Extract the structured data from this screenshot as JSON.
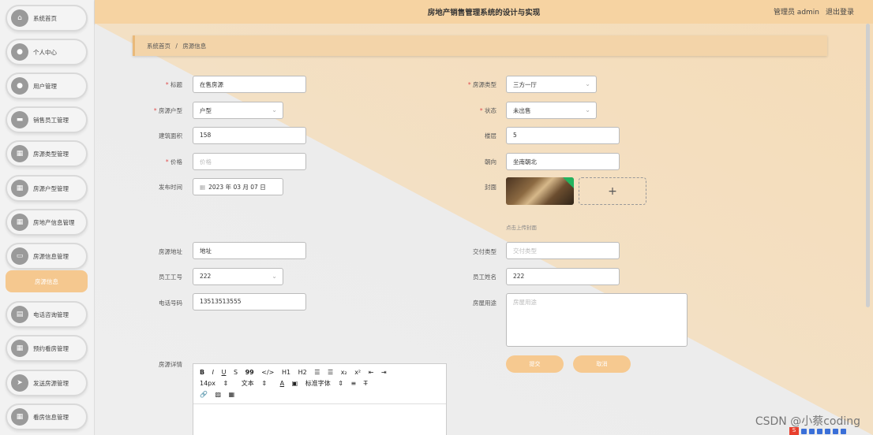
{
  "header": {
    "title": "房地产销售管理系统的设计与实现",
    "user": "管理员 admin",
    "logout": "退出登录"
  },
  "sidebar": {
    "items": [
      {
        "label": "系统首页",
        "icon": "home-icon"
      },
      {
        "label": "个人中心",
        "icon": "user-icon"
      },
      {
        "label": "用户管理",
        "icon": "users-icon"
      },
      {
        "label": "销售员工管理",
        "icon": "id-card-icon"
      },
      {
        "label": "房源类型管理",
        "icon": "grid-icon"
      },
      {
        "label": "房源户型管理",
        "icon": "grid-icon"
      },
      {
        "label": "房地产信息管理",
        "icon": "grid-icon"
      },
      {
        "label": "房源信息管理",
        "icon": "chat-icon"
      }
    ],
    "active_sub": "房源信息",
    "items_after": [
      {
        "label": "电话咨询管理",
        "icon": "document-icon"
      },
      {
        "label": "预约看房管理",
        "icon": "grid-icon"
      },
      {
        "label": "发送房源管理",
        "icon": "send-icon"
      },
      {
        "label": "看房信息管理",
        "icon": "grid-icon"
      }
    ]
  },
  "breadcrumb": {
    "home": "系统首页",
    "sep": "/",
    "current": "房源信息"
  },
  "form": {
    "title_label": "标题",
    "title_value": "在售房源",
    "type_label": "房源类型",
    "type_value": "三方一厅",
    "layout_label": "房源户型",
    "layout_value": "户型",
    "status_label": "状态",
    "status_value": "未出售",
    "area_label": "建筑面积",
    "area_value": "158",
    "floor_label": "楼层",
    "floor_value": "5",
    "price_label": "价格",
    "price_placeholder": "价格",
    "orientation_label": "朝向",
    "orientation_value": "坐南朝北",
    "date_label": "发布时间",
    "date_value": "2023 年 03 月 07 日",
    "cover_label": "封面",
    "cover_add": "+",
    "cover_hint": "点击上传封面",
    "address_label": "房源地址",
    "address_value": "地址",
    "delivery_label": "交付类型",
    "delivery_placeholder": "交付类型",
    "employee_no_label": "员工工号",
    "employee_no_value": "222",
    "employee_name_label": "员工姓名",
    "employee_name_value": "222",
    "phone_label": "电话号码",
    "phone_value": "13513513555",
    "usage_label": "房屋用途",
    "usage_placeholder": "房屋用途",
    "detail_label": "房源详情"
  },
  "editor": {
    "row1": [
      "B",
      "I",
      "U",
      "S",
      "99",
      "</>",
      "H1",
      "H2",
      "☰",
      "☰",
      "x₂",
      "x²",
      "⇤",
      "⇥"
    ],
    "font_size": "14px",
    "text_type": "文本",
    "font_family": "标准字体"
  },
  "buttons": {
    "submit": "提交",
    "cancel": "取消"
  },
  "watermark": "CSDN @小蔡coding"
}
